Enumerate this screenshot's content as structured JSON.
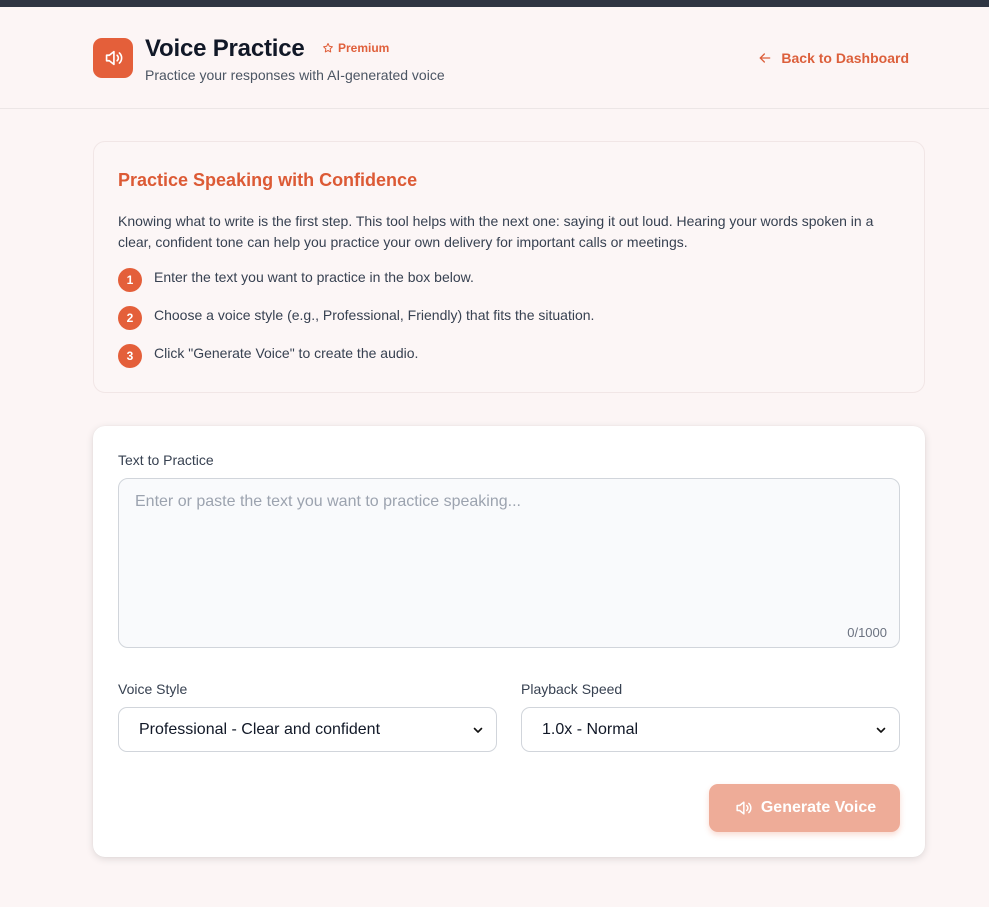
{
  "header": {
    "title": "Voice Practice",
    "badge": "Premium",
    "subtitle": "Practice your responses with AI-generated voice",
    "back_label": "Back to Dashboard"
  },
  "info": {
    "heading": "Practice Speaking with Confidence",
    "description": "Knowing what to write is the first step. This tool helps with the next one: saying it out loud. Hearing your words spoken in a clear, confident tone can help you practice your own delivery for important calls or meetings.",
    "steps": [
      {
        "number": "1",
        "text": "Enter the text you want to practice in the box below."
      },
      {
        "number": "2",
        "text": "Choose a voice style (e.g., Professional, Friendly) that fits the situation."
      },
      {
        "number": "3",
        "text": "Click \"Generate Voice\" to create the audio."
      }
    ]
  },
  "form": {
    "text_label": "Text to Practice",
    "text_placeholder": "Enter or paste the text you want to practice speaking...",
    "text_value": "",
    "char_count": "0/1000",
    "voice_style_label": "Voice Style",
    "voice_style_value": "Professional - Clear and confident",
    "speed_label": "Playback Speed",
    "speed_value": "1.0x - Normal",
    "generate_label": "Generate Voice"
  },
  "colors": {
    "accent": "#e45f3a",
    "accent_disabled": "#eeac98",
    "topbar": "#2f3542",
    "background": "#fcf5f5"
  },
  "icons": {
    "logo": "speaker-icon",
    "badge": "star-icon",
    "back": "arrow-left-icon",
    "select": "chevron-down-icon",
    "generate": "speaker-icon"
  }
}
